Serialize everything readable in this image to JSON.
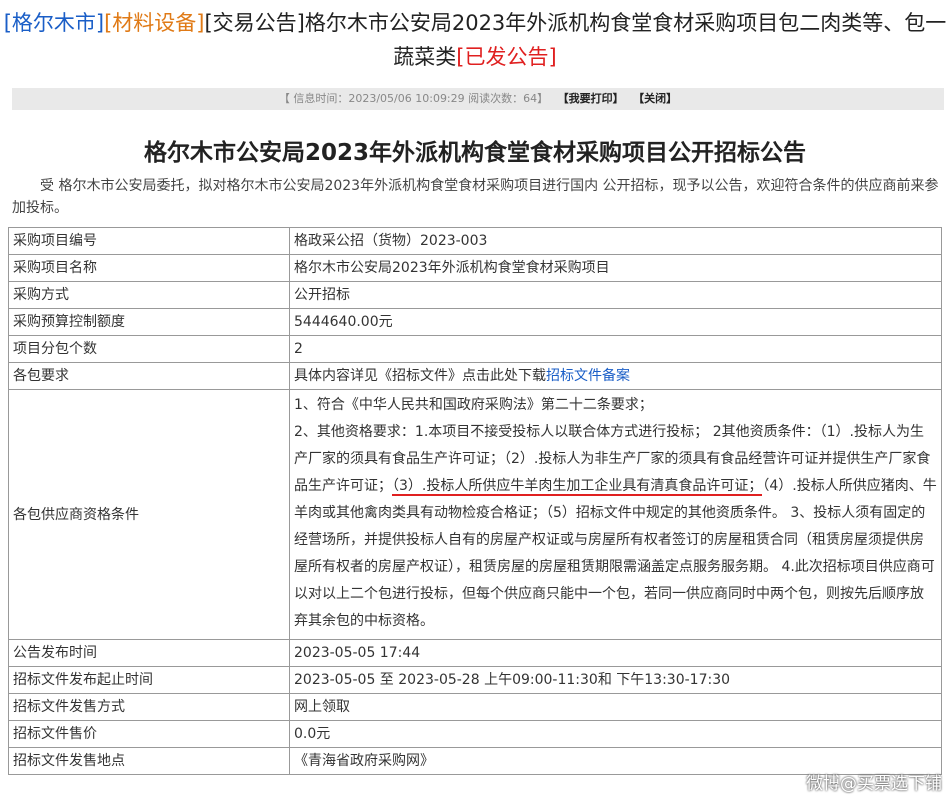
{
  "header": {
    "tag_city": "[格尔木市]",
    "tag_category": "[材料设备]",
    "title_text": "[交易公告]格尔木市公安局2023年外派机构食堂食材采购项目包二肉类等、包一蔬菜类",
    "tag_status": "[已发公告]"
  },
  "info_bar": {
    "meta_text": "【 信息时间：2023/05/06 10:09:29  阅读次数：64】",
    "print_label": "【我要打印】",
    "close_label": "【关闭】"
  },
  "notice": {
    "title": "格尔木市公安局2023年外派机构食堂食材采购项目公开招标公告",
    "intro": "受  格尔木市公安局委托，拟对格尔木市公安局2023年外派机构食堂食材采购项目进行国内  公开招标，现予以公告，欢迎符合条件的供应商前来参加投标。"
  },
  "table": {
    "rows": [
      {
        "k": "采购项目编号",
        "v": "格政采公招（货物）2023-003"
      },
      {
        "k": "采购项目名称",
        "v": "格尔木市公安局2023年外派机构食堂食材采购项目"
      },
      {
        "k": "采购方式",
        "v": "公开招标"
      },
      {
        "k": "采购预算控制额度",
        "v": "5444640.00元"
      },
      {
        "k": "项目分包个数",
        "v": "2"
      }
    ],
    "package_req_label": "各包要求",
    "package_req_prefix": "具体内容详见《招标文件》点击此处下载",
    "package_req_link": "招标文件备案",
    "qual_label": "各包供应商资格条件",
    "qual_part1": "1、符合《中华人民共和国政府采购法》第二十二条要求；",
    "qual_part2": "2、其他资格要求：1.本项目不接受投标人以联合体方式进行投标；  2其他资质条件：（1）.投标人为生产厂家的须具有食品生产许可证；（2）.投标人为非生产厂家的须具有食品经营许可证并提供生产厂家食品生产许可证；",
    "qual_highlight": "（3）.投标人所供应牛羊肉生加工企业具有清真食品许可证；",
    "qual_part3": "（4）.投标人所供应猪肉、牛羊肉或其他禽肉类具有动物检疫合格证；（5）招标文件中规定的其他资质条件。 3、投标人须有固定的经营场所，并提供投标人自有的房屋产权证或与房屋所有权者签订的房屋租赁合同（租赁房屋须提供房屋所有权者的房屋产权证），租赁房屋的房屋租赁期限需涵盖定点服务服务期。  4.此次招标项目供应商可以对以上二个包进行投标，但每个供应商只能中一个包，若同一供应商同时中两个包，则按先后顺序放弃其余包的中标资格。",
    "rows2": [
      {
        "k": "公告发布时间",
        "v": "2023-05-05  17:44"
      },
      {
        "k": "招标文件发布起止时间",
        "v": "2023-05-05  至  2023-05-28  上午09:00-11:30和  下午13:30-17:30"
      },
      {
        "k": "招标文件发售方式",
        "v": "网上领取"
      },
      {
        "k": "招标文件售价",
        "v": "0.0元"
      },
      {
        "k": "招标文件发售地点",
        "v": "《青海省政府采购网》"
      }
    ]
  },
  "watermark": "微博@买票选下铺"
}
